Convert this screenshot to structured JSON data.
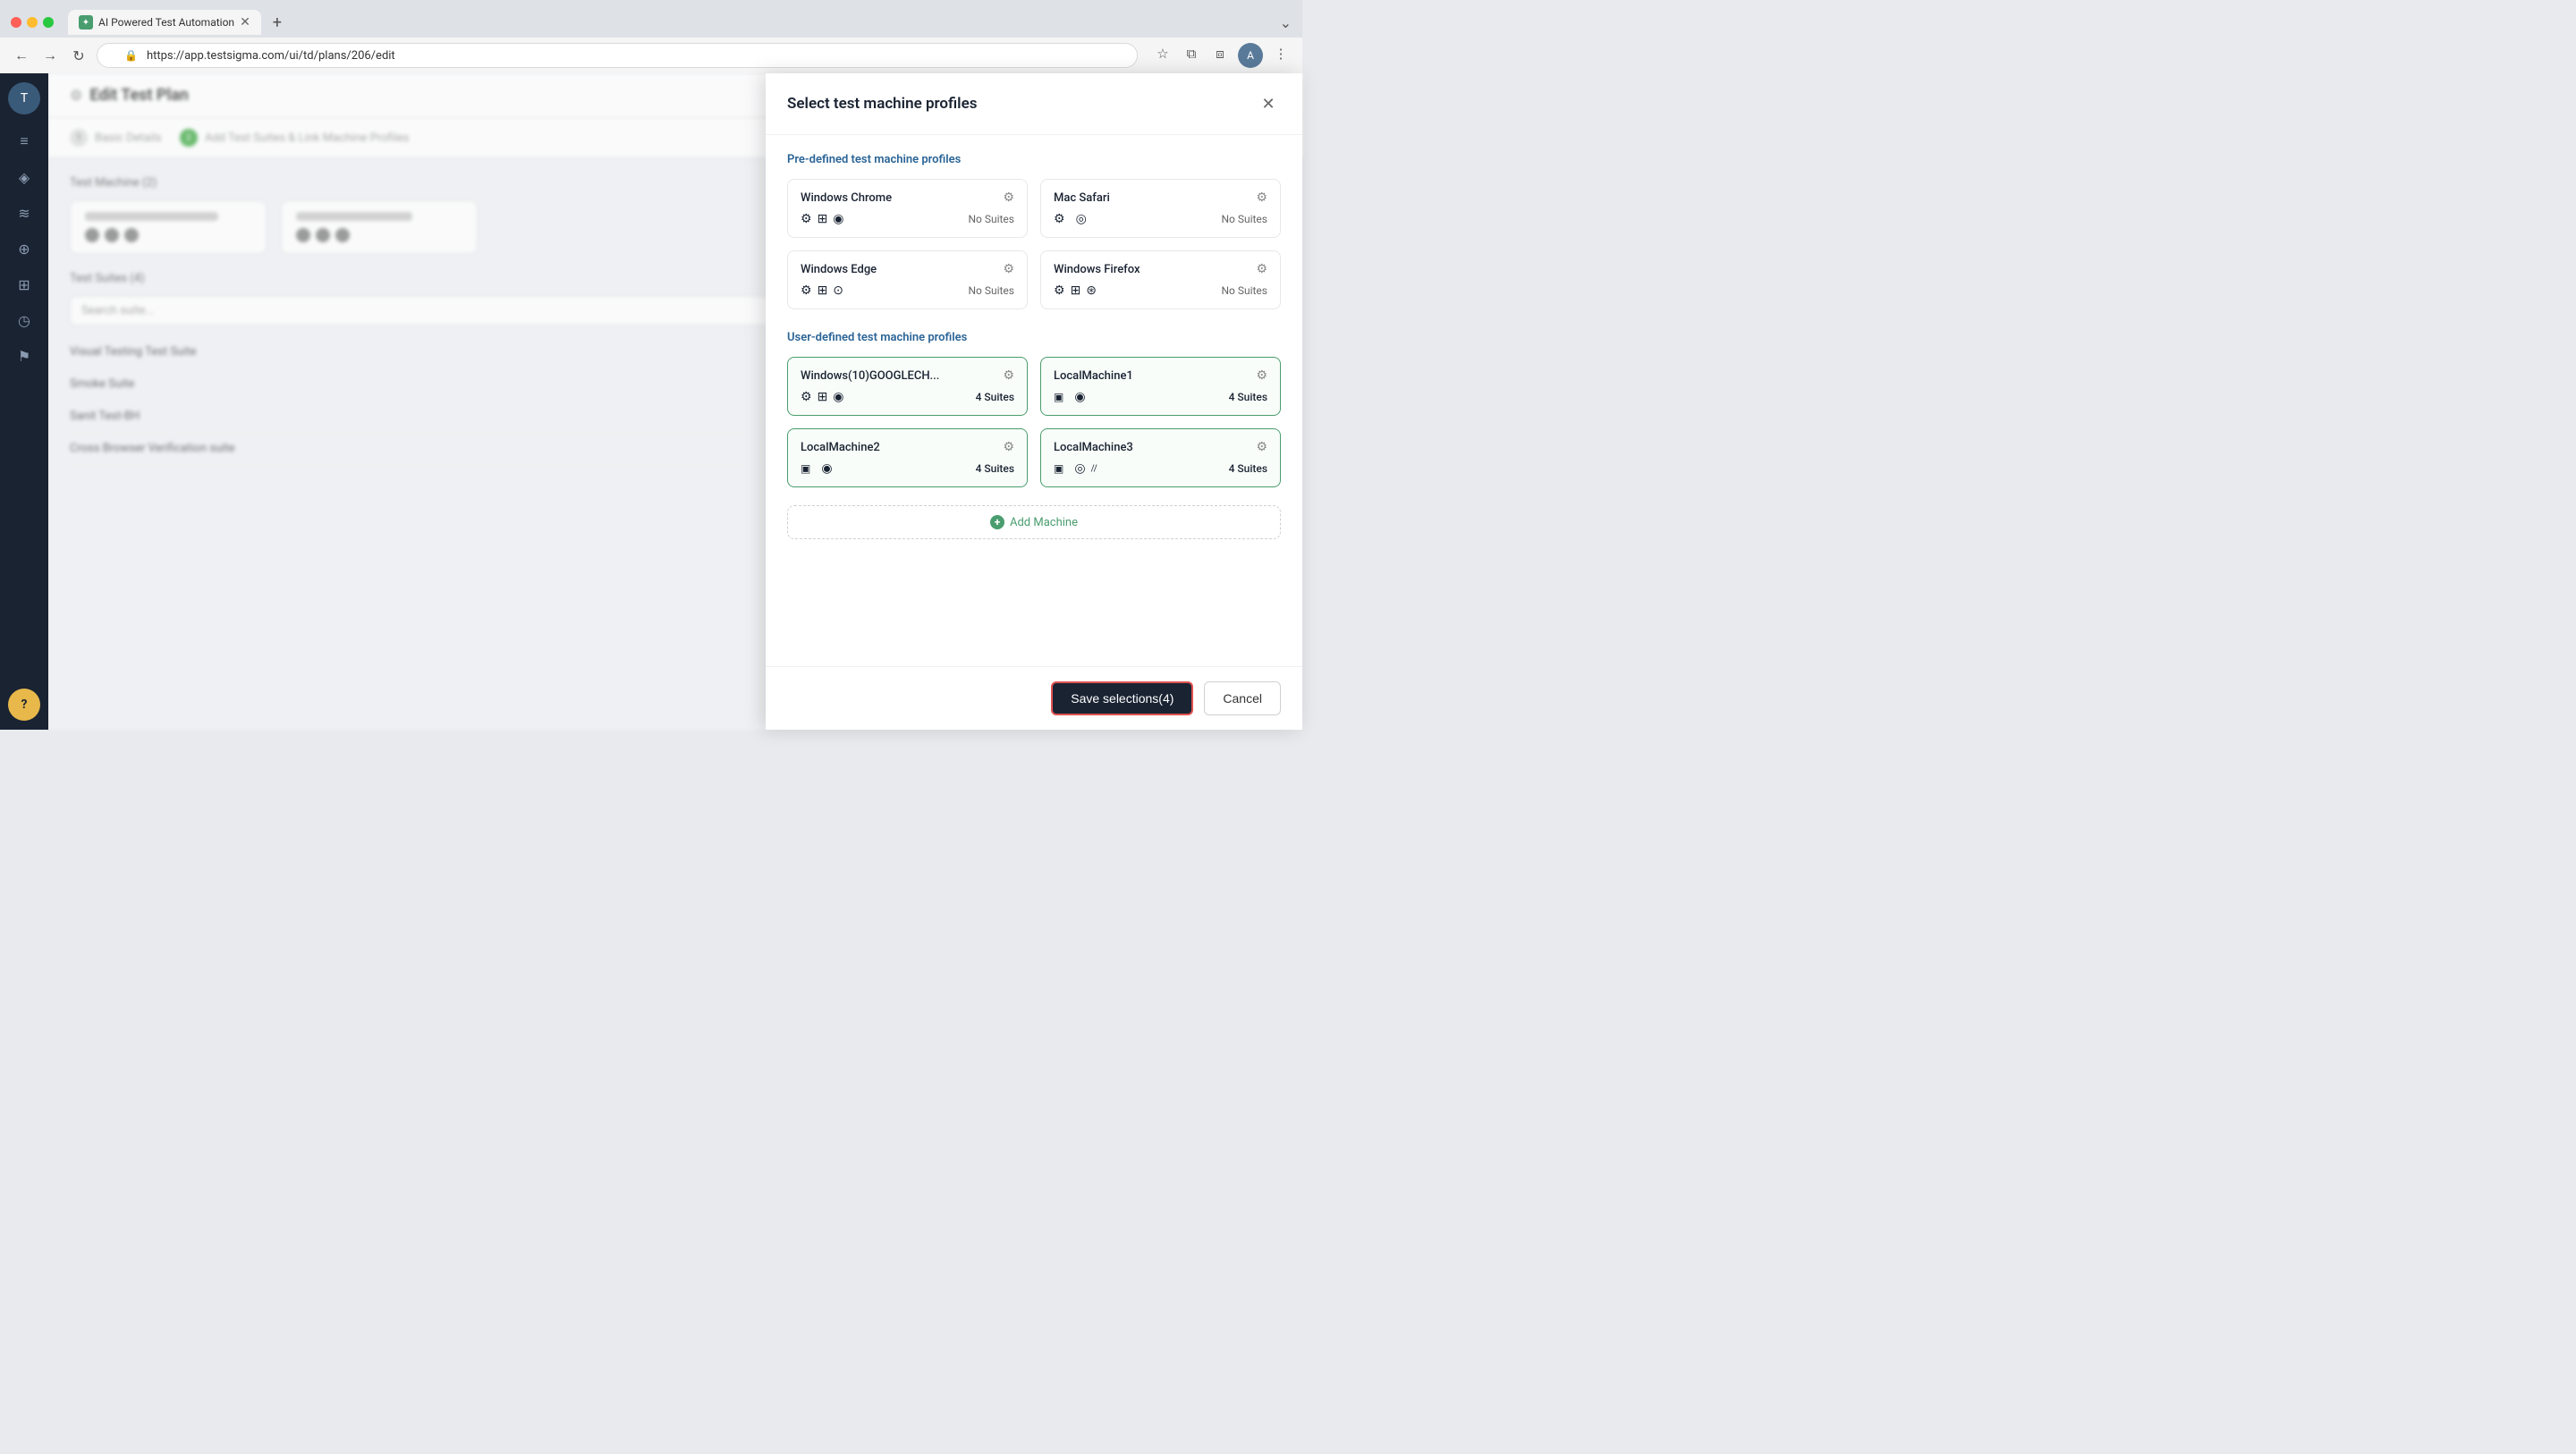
{
  "browser": {
    "tab_title": "AI Powered Test Automation",
    "tab_favicon": "✦",
    "url": "https://app.testsigma.com/ui/td/plans/206/edit",
    "new_tab_label": "+",
    "nav_back": "←",
    "nav_forward": "→",
    "nav_refresh": "↻",
    "star_label": "☆",
    "extensions_label": "⧉",
    "menu_label": "⋮",
    "tab_overflow": "⌄"
  },
  "modal": {
    "title": "Select test machine profiles",
    "close_label": "✕",
    "predefined_heading": "Pre-defined test machine profiles",
    "user_defined_heading": "User-defined test machine profiles",
    "predefined_profiles": [
      {
        "name": "Windows Chrome",
        "suites_label": "No Suites",
        "icons": [
          "⚙",
          "⊞",
          "◉"
        ]
      },
      {
        "name": "Mac Safari",
        "suites_label": "No Suites",
        "icons": [
          "⚙",
          "",
          "◎"
        ]
      },
      {
        "name": "Windows Edge",
        "suites_label": "No Suites",
        "icons": [
          "⚙",
          "⊞",
          "⊙"
        ]
      },
      {
        "name": "Windows Firefox",
        "suites_label": "No Suites",
        "icons": [
          "⚙",
          "⊞",
          "⊛"
        ]
      }
    ],
    "user_defined_profiles": [
      {
        "name": "Windows(10)GOOGLECH...",
        "suites_count": "4 Suites",
        "icons": [
          "⚙",
          "⊞",
          "◉"
        ]
      },
      {
        "name": "LocalMachine1",
        "suites_count": "4 Suites",
        "icons": [
          "▣",
          "",
          "◉"
        ]
      },
      {
        "name": "LocalMachine2",
        "suites_count": "4 Suites",
        "icons": [
          "▣",
          "",
          "◉"
        ]
      },
      {
        "name": "LocalMachine3",
        "suites_count": "4 Suites",
        "icons": [
          "▣",
          "",
          "◎",
          "//"
        ]
      }
    ],
    "add_machine_label": "Add Machine",
    "save_button_label": "Save selections(4)",
    "cancel_button_label": "Cancel"
  },
  "sidebar": {
    "avatar_label": "T",
    "items": [
      {
        "icon": "≡",
        "name": "menu"
      },
      {
        "icon": "◈",
        "name": "dashboard"
      },
      {
        "icon": "≋",
        "name": "tests"
      },
      {
        "icon": "⊕",
        "name": "create"
      },
      {
        "icon": "⊞",
        "name": "grid"
      },
      {
        "icon": "◷",
        "name": "clock"
      },
      {
        "icon": "⚑",
        "name": "flag"
      }
    ],
    "bottom_items": [
      {
        "icon": "?",
        "name": "help"
      }
    ]
  },
  "background": {
    "page_title": "Edit Test Plan",
    "steps": [
      {
        "label": "Basic Details",
        "active": false
      },
      {
        "label": "Add Test Suites & Link Machine Profiles",
        "active": true
      }
    ],
    "machine_section": "Test Machine (2)",
    "suites_section": "Test Suites (4)",
    "list_items": [
      "Visual Testing Test Suite",
      "Smoke Suite",
      "Sanit Test-BH",
      "Cross Browser Verification suite"
    ]
  }
}
